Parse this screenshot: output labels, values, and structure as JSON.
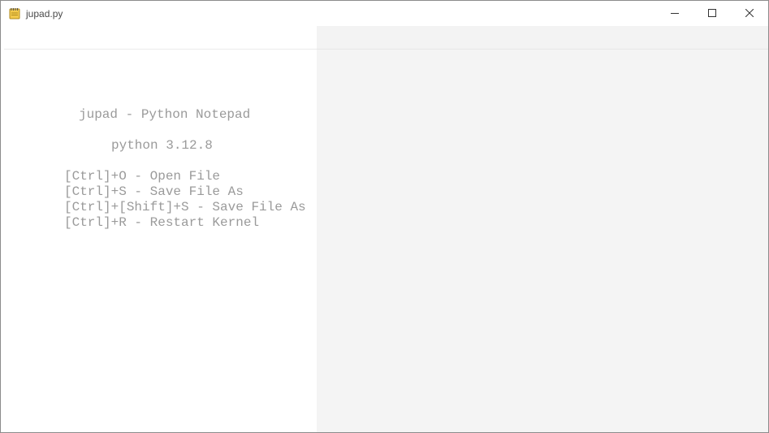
{
  "window": {
    "title": "jupad.py",
    "app_icon": "notepad-icon",
    "controls": {
      "minimize_icon": "minimize-icon",
      "maximize_icon": "maximize-icon",
      "close_icon": "close-icon"
    }
  },
  "welcome": {
    "heading": "jupad - Python Notepad",
    "version": "python 3.12.8",
    "shortcuts": [
      "[Ctrl]+O - Open File",
      "[Ctrl]+S - Save File As",
      "[Ctrl]+[Shift]+S - Save File As",
      "[Ctrl]+R - Restart Kernel"
    ]
  },
  "colors": {
    "text": "#9a9a9a",
    "right_pane_bg": "#f4f4f4",
    "icon_yellow": "#f2c94c"
  }
}
